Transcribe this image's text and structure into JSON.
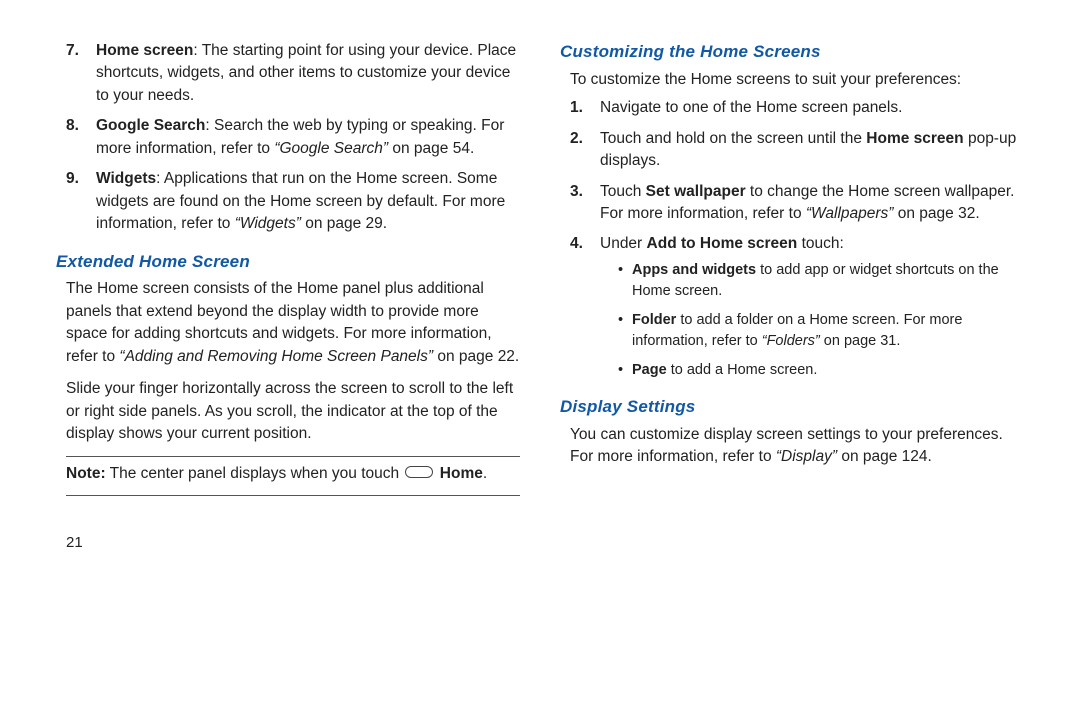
{
  "left": {
    "items": [
      {
        "n": "7.",
        "title": "Home screen",
        "desc": ": The starting point for using your device. Place shortcuts, widgets, and other items to customize your device to your needs."
      },
      {
        "n": "8.",
        "title": "Google Search",
        "desc_a": ": Search the web by typing or speaking. For more information, refer to ",
        "ref": "“Google Search”",
        "desc_b": " on page 54."
      },
      {
        "n": "9.",
        "title": "Widgets",
        "desc_a": ": Applications that run on the Home screen. Some widgets are found on the Home screen by default. For more information, refer to ",
        "ref": "“Widgets”",
        "desc_b": " on page 29."
      }
    ],
    "h1": "Extended Home Screen",
    "p1_a": "The Home screen consists of the Home panel plus additional panels that extend beyond the display width to provide more space for adding shortcuts and widgets. For more information, refer to ",
    "p1_ref": "“Adding and Removing Home Screen Panels”",
    "p1_b": " on page 22.",
    "p2": "Slide your finger horizontally across the screen to scroll to the left or right side panels. As you scroll, the indicator at the top of the display shows your current position.",
    "note_label": "Note:",
    "note_text": " The center panel displays when you touch ",
    "note_home": "Home",
    "note_period": ".",
    "pagenum": "21"
  },
  "right": {
    "h1": "Customizing the Home Screens",
    "intro": "To customize the Home screens to suit your preferences:",
    "steps": [
      {
        "n": "1.",
        "text": "Navigate to one of the Home screen panels."
      },
      {
        "n": "2.",
        "a": "Touch and hold on the screen until the ",
        "b": "Home screen",
        "c": " pop-up displays."
      },
      {
        "n": "3.",
        "a": "Touch ",
        "b": "Set wallpaper",
        "c": " to change the Home screen wallpaper. For more information, refer to ",
        "ref": "“Wallpapers”",
        "d": " on page 32."
      },
      {
        "n": "4.",
        "a": "Under ",
        "b": "Add to Home screen",
        "c": " touch:"
      }
    ],
    "bullets": [
      {
        "b": "Apps and widgets",
        "t": " to add app or widget shortcuts on the Home screen."
      },
      {
        "b": "Folder",
        "t_a": " to add a folder on a Home screen. For more information, refer to ",
        "ref": "“Folders”",
        "t_b": " on page 31."
      },
      {
        "b": "Page",
        "t": " to add a Home screen."
      }
    ],
    "h2": "Display Settings",
    "ds_a": "You can customize display screen settings to your preferences. For more information, refer to ",
    "ds_ref": "“Display”",
    "ds_b": " on page 124."
  }
}
